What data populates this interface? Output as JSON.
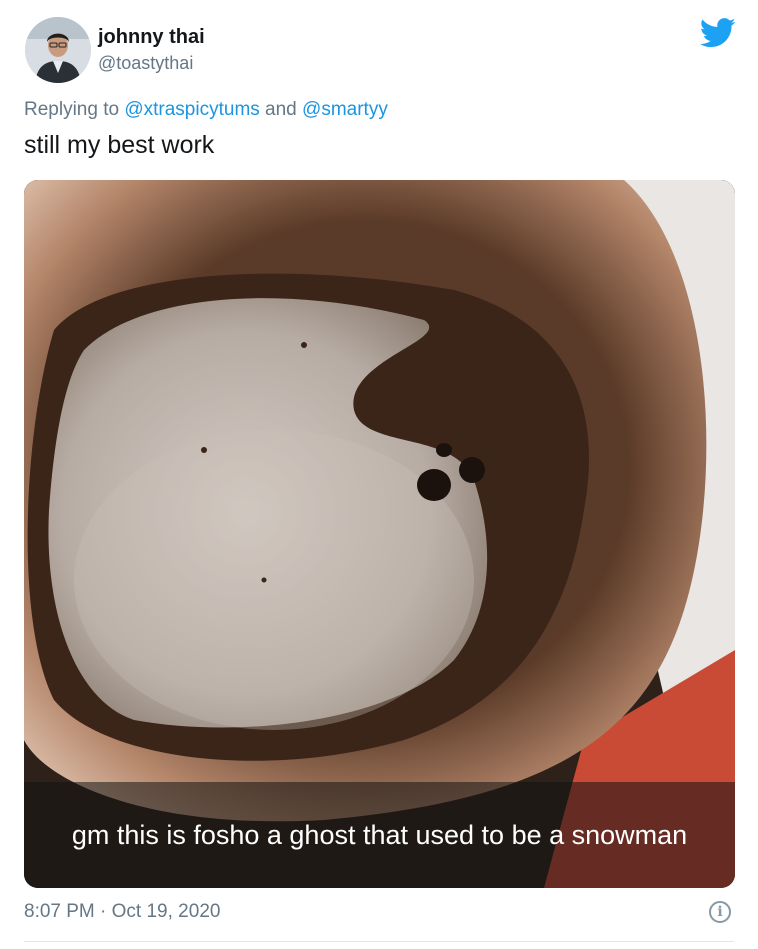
{
  "tweet": {
    "author_name": "johnny thai",
    "author_handle": "@toastythai",
    "replying_prefix": "Replying to",
    "replying_users": [
      "@xtraspicytums",
      "@smartyy"
    ],
    "replying_joiner": "and",
    "text": "still my best work",
    "image_caption": "gm this is fosho a ghost that used to be a snowman",
    "time": "8:07 PM",
    "separator": "·",
    "date": "Oct 19, 2020"
  },
  "icons": {
    "platform": "twitter-bird-icon",
    "info": "info-icon"
  },
  "colors": {
    "twitter_blue": "#1da1f2",
    "mention_blue": "#1b95e0",
    "secondary_text": "#657786"
  }
}
